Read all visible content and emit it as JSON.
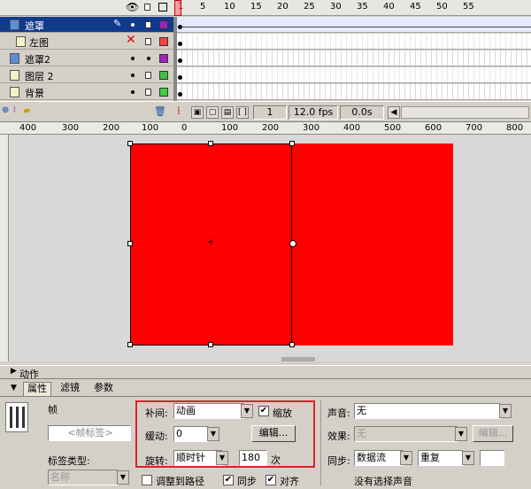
{
  "timeline": {
    "header_icons": [
      "eye-icon",
      "lock-icon",
      "outline-icon"
    ],
    "frame_numbers": [
      "1",
      "5",
      "10",
      "15",
      "20",
      "25",
      "30",
      "35",
      "40",
      "45",
      "50",
      "55"
    ],
    "layers": [
      {
        "name": "遮罩",
        "type": "mask",
        "selected": true,
        "color": "#a020c0",
        "locked": true
      },
      {
        "name": "左图",
        "type": "normal",
        "selected": false,
        "color": "#ff4040",
        "locked": true
      },
      {
        "name": "遮罩2",
        "type": "mask",
        "selected": false,
        "color": "#a020c0",
        "locked": false
      },
      {
        "name": "图层 2",
        "type": "normal",
        "selected": false,
        "color": "#40c040",
        "locked": true
      },
      {
        "name": "背景",
        "type": "normal",
        "selected": false,
        "color": "#40d040",
        "locked": true
      }
    ],
    "current_frame": "1",
    "fps": "12.0 fps",
    "time": "0.0s"
  },
  "ruler": {
    "labels": [
      "400",
      "300",
      "200",
      "100",
      "0",
      "100",
      "200",
      "300",
      "400",
      "500",
      "600",
      "700",
      "800"
    ]
  },
  "panels": {
    "actions_label": "动作",
    "tabs": [
      "属性",
      "滤镜",
      "参数"
    ],
    "frame_label": "帧",
    "frame_name_placeholder": "<帧标签>",
    "label_type_label": "标签类型:",
    "label_type_value": "名称",
    "tween_label": "补间:",
    "tween_value": "动画",
    "scale_label": "缩放",
    "ease_label": "缓动:",
    "ease_value": "0",
    "edit_button": "编辑...",
    "rotate_label": "旋转:",
    "rotate_value": "顺时针",
    "rotate_count": "180",
    "rotate_unit": "次",
    "orient_path_label": "调整到路径",
    "sync_label": "同步",
    "snap_label": "对齐",
    "sound_label": "声音:",
    "sound_value": "无",
    "effect_label": "效果:",
    "effect_value": "无",
    "edit2_button": "编辑...",
    "sync2_label": "同步:",
    "sync2_value": "数据流",
    "repeat_value": "重复",
    "no_sound_text": "没有选择声音"
  }
}
